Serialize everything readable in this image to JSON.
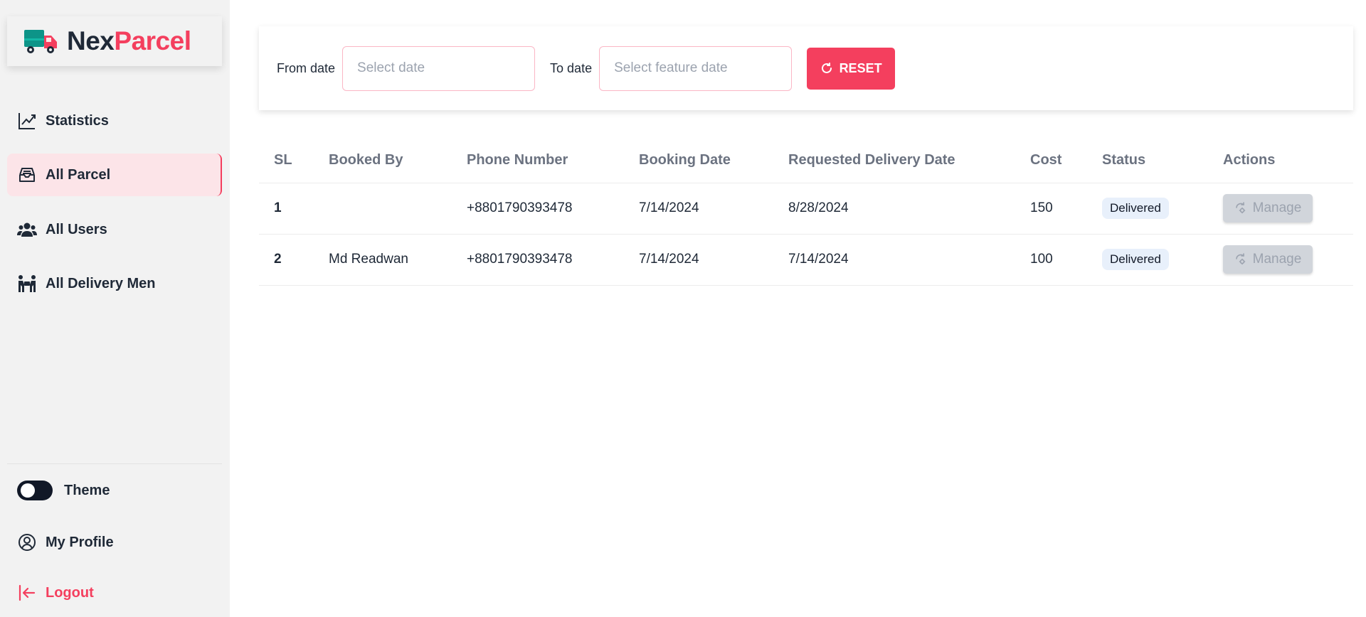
{
  "brand": {
    "part1": "Nex",
    "part2": "Parcel",
    "accent": "#f43f5e"
  },
  "sidebar": {
    "items": [
      {
        "label": "Statistics",
        "icon": "chart-line-icon"
      },
      {
        "label": "All Parcel",
        "icon": "inbox-icon",
        "active": true
      },
      {
        "label": "All Users",
        "icon": "users-icon"
      },
      {
        "label": "All Delivery Men",
        "icon": "people-carry-icon"
      }
    ],
    "bottom": {
      "theme_label": "Theme",
      "profile_label": "My Profile",
      "logout_label": "Logout"
    }
  },
  "filters": {
    "from_label": "From date",
    "from_placeholder": "Select date",
    "to_label": "To date",
    "to_placeholder": "Select feature date",
    "reset_label": "RESET"
  },
  "table": {
    "headers": [
      "SL",
      "Booked By",
      "Phone Number",
      "Booking Date",
      "Requested Delivery Date",
      "Cost",
      "Status",
      "Actions"
    ],
    "rows": [
      {
        "sl": "1",
        "booked_by": "",
        "phone": "+8801790393478",
        "booking_date": "7/14/2024",
        "requested_date": "8/28/2024",
        "cost": "150",
        "status": "Delivered",
        "action": "Manage"
      },
      {
        "sl": "2",
        "booked_by": "Md Readwan",
        "phone": "+8801790393478",
        "booking_date": "7/14/2024",
        "requested_date": "7/14/2024",
        "cost": "100",
        "status": "Delivered",
        "action": "Manage"
      }
    ]
  }
}
